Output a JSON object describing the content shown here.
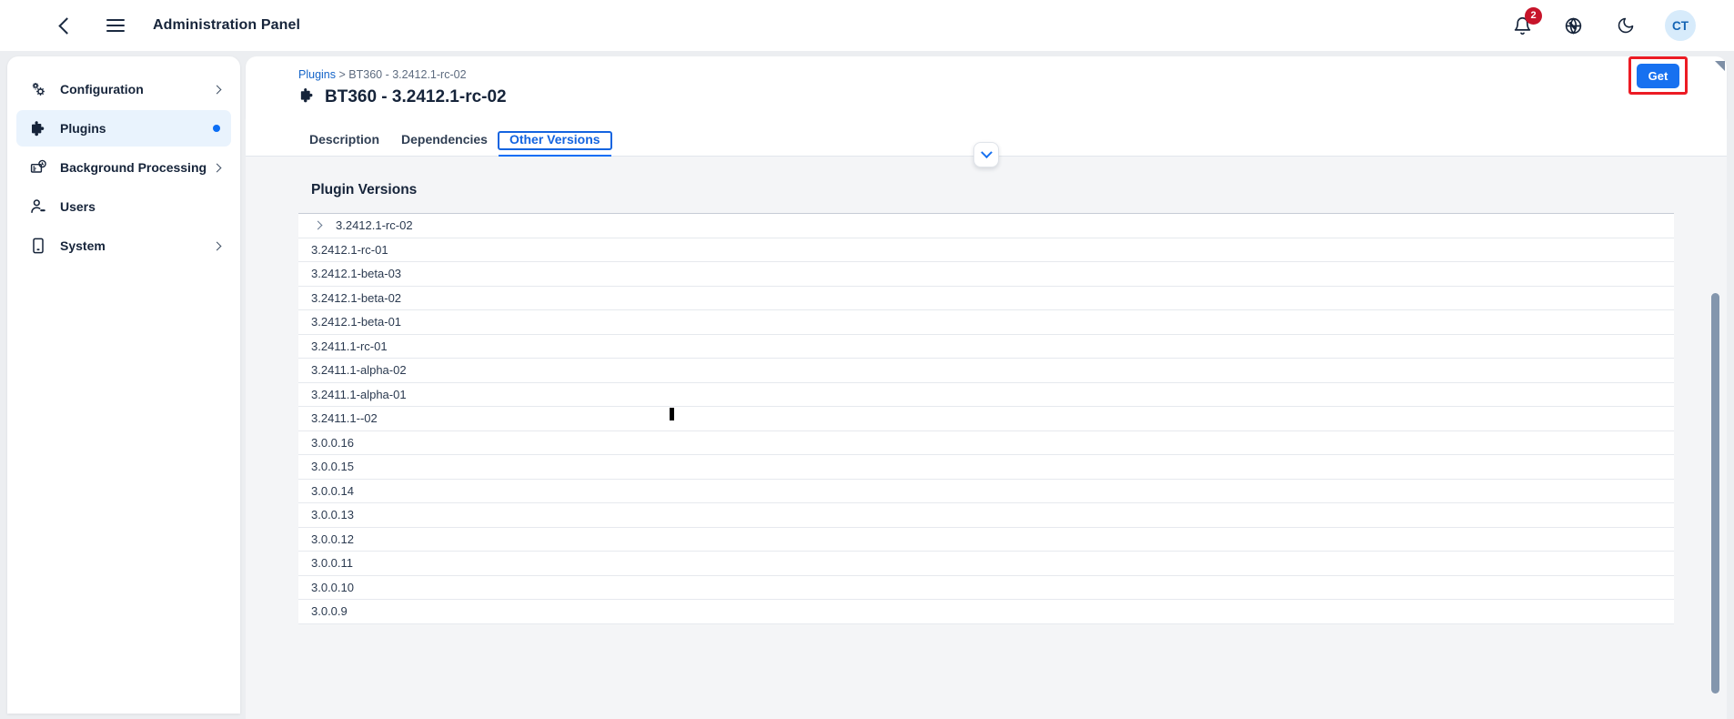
{
  "topbar": {
    "back_icon": "chevron-left-icon",
    "menu_icon": "hamburger-menu-icon",
    "title": "Administration Panel",
    "notifications": {
      "icon": "bell-icon",
      "count": "2"
    },
    "language_icon": "globe-icon",
    "theme_icon": "moon-icon",
    "avatar_initials": "CT"
  },
  "sidebar": {
    "items": [
      {
        "label": "Configuration",
        "icon": "gears-icon",
        "trailing": "chevron-right"
      },
      {
        "label": "Plugins",
        "icon": "puzzle-piece-icon",
        "trailing": "dot",
        "active": true
      },
      {
        "label": "Background Processing",
        "icon": "queue-clock-icon",
        "trailing": "chevron-right"
      },
      {
        "label": "Users",
        "icon": "user-icon",
        "trailing": "none"
      },
      {
        "label": "System",
        "icon": "device-icon",
        "trailing": "chevron-right"
      }
    ]
  },
  "page": {
    "breadcrumb": {
      "root": "Plugins",
      "separator": ">",
      "current": "BT360 - 3.2412.1-rc-02"
    },
    "title": "BT360 - 3.2412.1-rc-02",
    "title_icon": "puzzle-piece-icon",
    "get_button": "Get",
    "collapse_button_icon": "chevron-down-icon"
  },
  "tabs": [
    {
      "label": "Description",
      "active": false
    },
    {
      "label": "Dependencies",
      "active": false
    },
    {
      "label": "Other Versions",
      "active": true
    }
  ],
  "versions_section": {
    "heading": "Plugin Versions",
    "rows": [
      {
        "label": "3.2412.1-rc-02",
        "expandable": true
      },
      {
        "label": "3.2412.1-rc-01",
        "expandable": false
      },
      {
        "label": "3.2412.1-beta-03",
        "expandable": false
      },
      {
        "label": "3.2412.1-beta-02",
        "expandable": false
      },
      {
        "label": "3.2412.1-beta-01",
        "expandable": false
      },
      {
        "label": "3.2411.1-rc-01",
        "expandable": false
      },
      {
        "label": "3.2411.1-alpha-02",
        "expandable": false
      },
      {
        "label": "3.2411.1-alpha-01",
        "expandable": false
      },
      {
        "label": "3.2411.1--02",
        "expandable": false
      },
      {
        "label": "3.0.0.16",
        "expandable": false
      },
      {
        "label": "3.0.0.15",
        "expandable": false
      },
      {
        "label": "3.0.0.14",
        "expandable": false
      },
      {
        "label": "3.0.0.13",
        "expandable": false
      },
      {
        "label": "3.0.0.12",
        "expandable": false
      },
      {
        "label": "3.0.0.11",
        "expandable": false
      },
      {
        "label": "3.0.0.10",
        "expandable": false
      },
      {
        "label": "3.0.0.9",
        "expandable": false
      }
    ]
  },
  "colors": {
    "accent_blue": "#0b6ef5",
    "link_blue": "#1464c8",
    "highlight_red": "#ec1b24",
    "badge_red": "#c7142a",
    "page_bg": "#eceef1",
    "content_bg": "#f4f5f7",
    "text_dark": "#16243a"
  }
}
